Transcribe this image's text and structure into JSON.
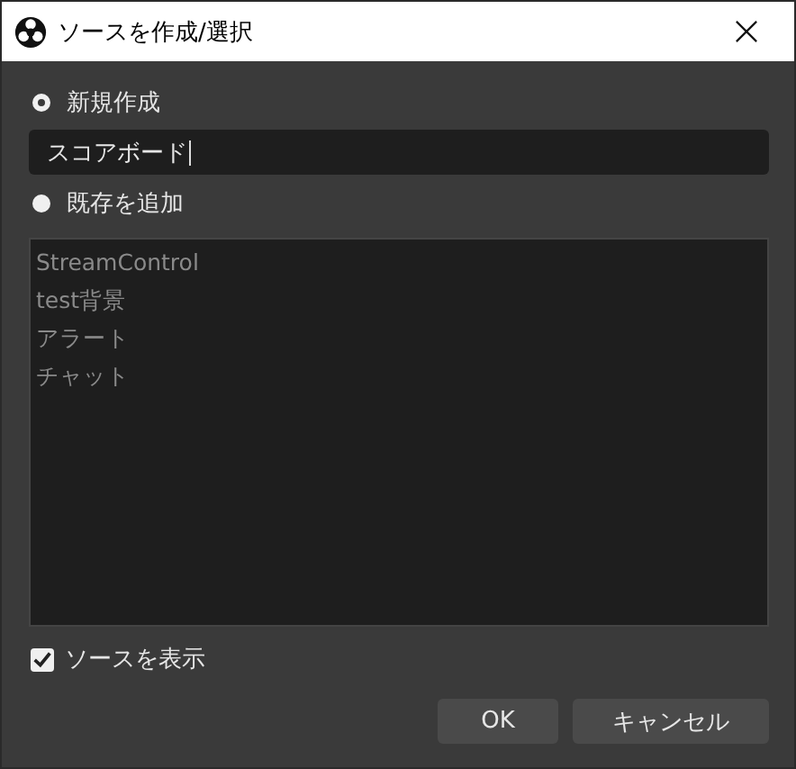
{
  "window": {
    "title": "ソースを作成/選択"
  },
  "options": [
    {
      "label": "新規作成",
      "selected": true
    },
    {
      "label": "既存を追加",
      "selected": false
    }
  ],
  "name_field": {
    "value": "スコアボード"
  },
  "existing_list": {
    "disabled": true,
    "items": [
      "StreamControl",
      "test背景",
      "アラート",
      "チャット"
    ]
  },
  "show_source": {
    "label": "ソースを表示",
    "checked": true
  },
  "buttons": [
    "OK",
    "キャンセル"
  ]
}
